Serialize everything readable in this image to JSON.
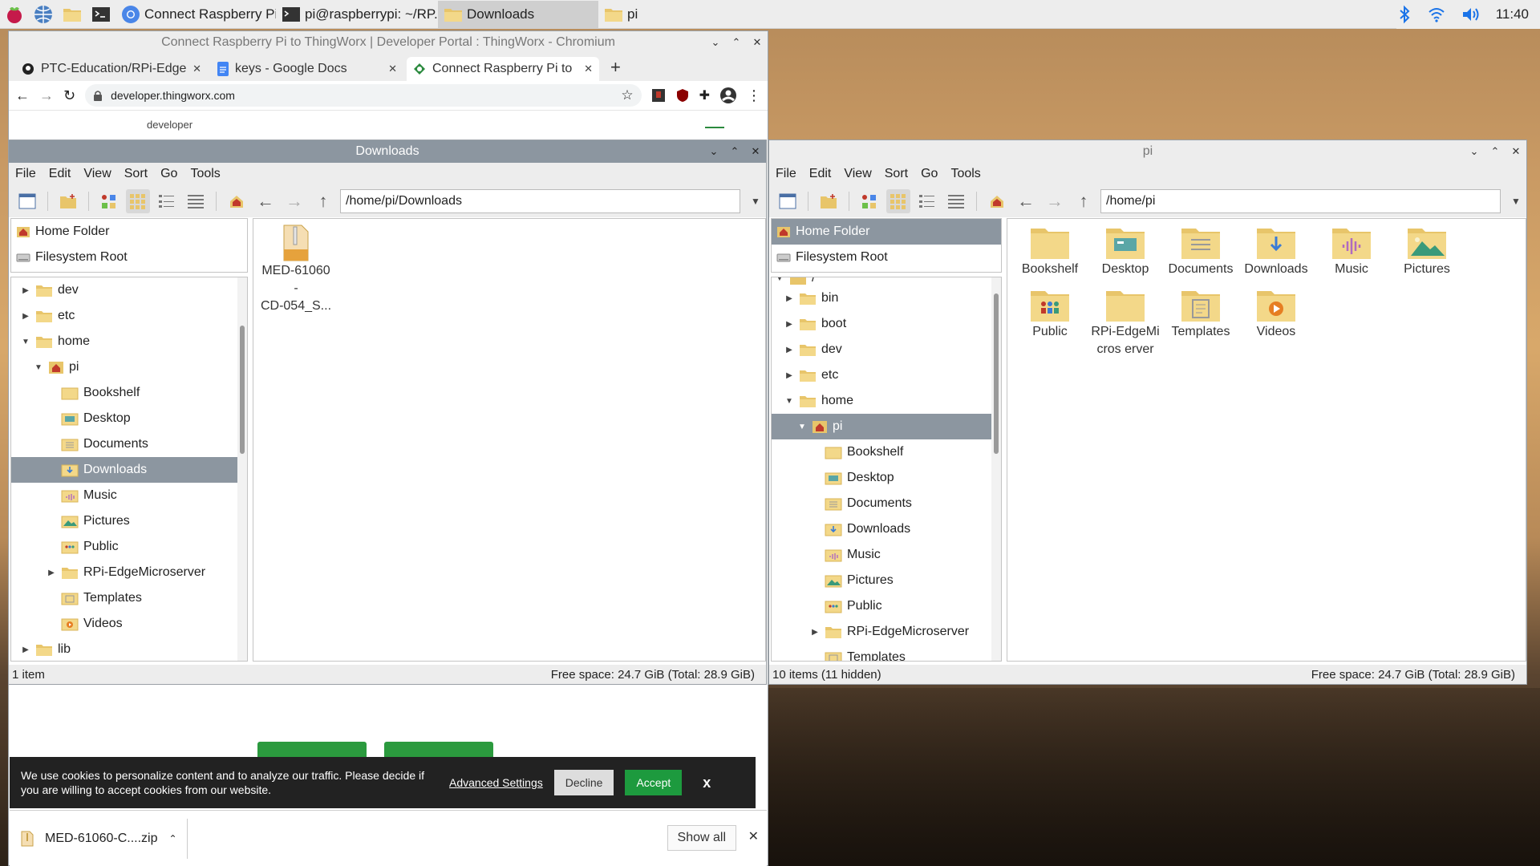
{
  "taskbar": {
    "tasks": [
      {
        "label": "Connect Raspberry Pi..."
      },
      {
        "label": "pi@raspberrypi: ~/RP..."
      },
      {
        "label": "Downloads"
      },
      {
        "label": "pi"
      }
    ],
    "clock": "11:40"
  },
  "chromium": {
    "title": "Connect Raspberry Pi to ThingWorx | Developer Portal : ThingWorx - Chromium",
    "tabs": [
      {
        "label": "PTC-Education/RPi-Edge"
      },
      {
        "label": "keys - Google Docs"
      },
      {
        "label": "Connect Raspberry Pi to"
      }
    ],
    "url": "developer.thingworx.com",
    "page_header_text": "developer",
    "cookie": {
      "text": "We use cookies to personalize content and to analyze our traffic. Please decide if you are willing to accept cookies from our website.",
      "advanced": "Advanced Settings",
      "decline": "Decline",
      "accept": "Accept",
      "close": "x"
    },
    "download": {
      "filename": "MED-61060-C....zip",
      "show_all": "Show all"
    }
  },
  "fm_downloads": {
    "title": "Downloads",
    "menu": [
      "File",
      "Edit",
      "View",
      "Sort",
      "Go",
      "Tools"
    ],
    "path": "/home/pi/Downloads",
    "places": [
      "Home Folder",
      "Filesystem Root"
    ],
    "tree": [
      {
        "label": "dev"
      },
      {
        "label": "etc"
      },
      {
        "label": "home"
      },
      {
        "label": "pi"
      },
      {
        "label": "Bookshelf"
      },
      {
        "label": "Desktop"
      },
      {
        "label": "Documents"
      },
      {
        "label": "Downloads"
      },
      {
        "label": "Music"
      },
      {
        "label": "Pictures"
      },
      {
        "label": "Public"
      },
      {
        "label": "RPi-EdgeMicroserver"
      },
      {
        "label": "Templates"
      },
      {
        "label": "Videos"
      },
      {
        "label": "lib"
      }
    ],
    "files": [
      {
        "line1": "MED-61060",
        "line2": "-",
        "line3": "CD-054_S..."
      }
    ],
    "status_left": "1 item",
    "status_right": "Free space: 24.7 GiB (Total: 28.9 GiB)"
  },
  "fm_pi": {
    "title": "pi",
    "menu": [
      "File",
      "Edit",
      "View",
      "Sort",
      "Go",
      "Tools"
    ],
    "path": "/home/pi",
    "places": [
      "Home Folder",
      "Filesystem Root"
    ],
    "tree": [
      {
        "label": "/"
      },
      {
        "label": "bin"
      },
      {
        "label": "boot"
      },
      {
        "label": "dev"
      },
      {
        "label": "etc"
      },
      {
        "label": "home"
      },
      {
        "label": "pi"
      },
      {
        "label": "Bookshelf"
      },
      {
        "label": "Desktop"
      },
      {
        "label": "Documents"
      },
      {
        "label": "Downloads"
      },
      {
        "label": "Music"
      },
      {
        "label": "Pictures"
      },
      {
        "label": "Public"
      },
      {
        "label": "RPi-EdgeMicroserver"
      },
      {
        "label": "Templates"
      }
    ],
    "files": [
      {
        "label": "Bookshelf"
      },
      {
        "label": "Desktop"
      },
      {
        "label": "Documents"
      },
      {
        "label": "Downloads"
      },
      {
        "label": "Music"
      },
      {
        "label": "Pictures"
      },
      {
        "label": "Public"
      },
      {
        "label": "RPi-EdgeMicros erver"
      },
      {
        "label": "Templates"
      },
      {
        "label": "Videos"
      }
    ],
    "status_left": "10 items (11 hidden)",
    "status_right": "Free space: 24.7 GiB (Total: 28.9 GiB)"
  }
}
